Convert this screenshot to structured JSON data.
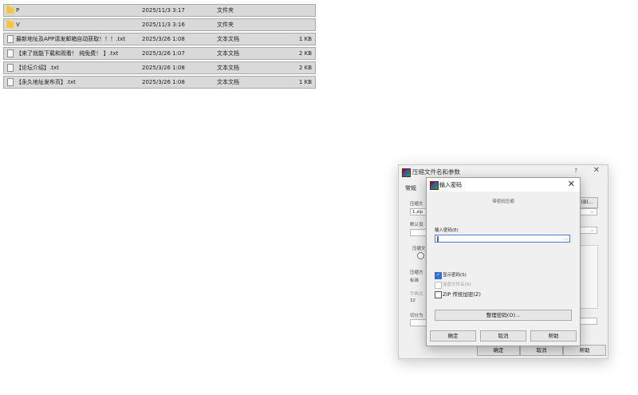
{
  "files": [
    {
      "name": "P",
      "date": "2025/11/3 3:17",
      "type": "文件夹",
      "size": "",
      "icon": "folder-icon"
    },
    {
      "name": "V",
      "date": "2025/11/3 3:16",
      "type": "文件夹",
      "size": "",
      "icon": "folder-icon"
    },
    {
      "name": "最新地址及APP请发邮箱自动获取！！！.txt",
      "date": "2025/3/26 1:08",
      "type": "文本文档",
      "size": "1 KB",
      "icon": "text-file-icon"
    },
    {
      "name": "【来了就能下载和观看！ 纯免费！ 】.txt",
      "date": "2025/3/26 1:07",
      "type": "文本文档",
      "size": "2 KB",
      "icon": "text-file-icon"
    },
    {
      "name": "【论坛介绍】.txt",
      "date": "2025/3/26 1:08",
      "type": "文本文档",
      "size": "2 KB",
      "icon": "text-file-icon"
    },
    {
      "name": "【永久地址发布页】.txt",
      "date": "2025/3/26 1:08",
      "type": "文本文档",
      "size": "1 KB",
      "icon": "text-file-icon"
    }
  ],
  "archive_dialog": {
    "title": "压缩文件名和参数",
    "help": "?",
    "close": "✕",
    "tab_general": "常规",
    "archive_name_label": "压缩文",
    "archive_name_value": "1.zip",
    "browse_button": "(B)...",
    "default_label": "默认设",
    "format_label": "压缩文",
    "method_label": "压缩方",
    "method_value": "标准",
    "dict_label": "字典大",
    "dict_value": "32",
    "split_label": "切分为",
    "ok_button": "确定",
    "cancel_button": "取消",
    "help_button": "帮助"
  },
  "password_dialog": {
    "title": "输入密码",
    "close": "✕",
    "subtitle": "带密码压缩",
    "enter_password_label": "输入密码(E)",
    "password_value": "",
    "show_password": {
      "label": "显示密码(S)",
      "checked": true,
      "enabled": true
    },
    "encrypt_filenames": {
      "label": "加密文件名(N)",
      "checked": false,
      "enabled": false
    },
    "zip_legacy": {
      "label": "ZIP 传统加密(Z)",
      "checked": false,
      "enabled": true
    },
    "organize_button": "整理密码(O)...",
    "ok_button": "确定",
    "cancel_button": "取消",
    "help_button": "帮助"
  }
}
